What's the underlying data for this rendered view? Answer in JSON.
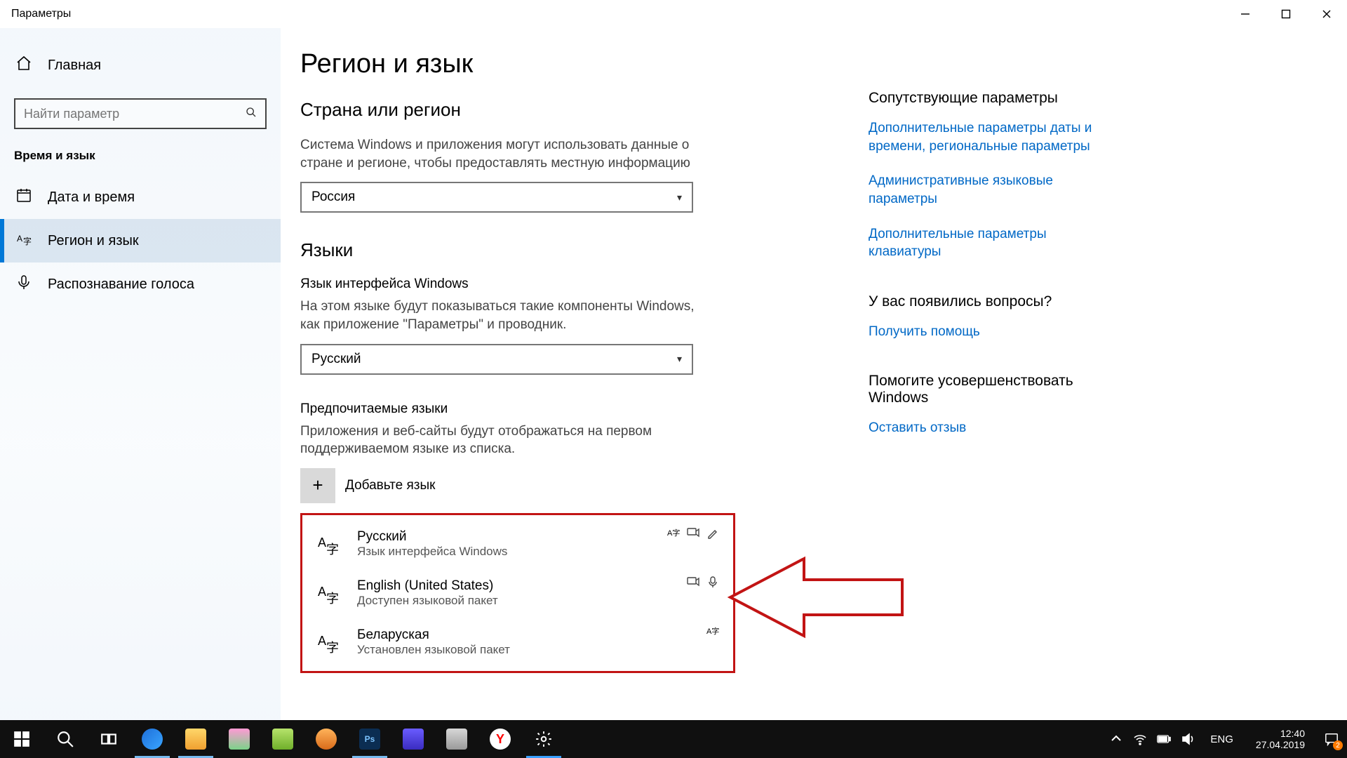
{
  "window": {
    "title": "Параметры"
  },
  "sidebar": {
    "home": "Главная",
    "search_placeholder": "Найти параметр",
    "section": "Время и язык",
    "items": [
      {
        "label": "Дата и время"
      },
      {
        "label": "Регион и язык"
      },
      {
        "label": "Распознавание голоса"
      }
    ]
  },
  "main": {
    "title": "Регион и язык",
    "region": {
      "heading": "Страна или регион",
      "desc": "Система Windows и приложения могут использовать данные о стране и регионе, чтобы предоставлять местную информацию",
      "value": "Россия"
    },
    "languages": {
      "heading": "Языки",
      "uilang_label": "Язык интерфейса Windows",
      "uilang_desc": "На этом языке будут показываться такие компоненты Windows, как приложение \"Параметры\" и проводник.",
      "uilang_value": "Русский",
      "pref_label": "Предпочитаемые языки",
      "pref_desc": "Приложения и веб-сайты будут отображаться на первом поддерживаемом языке из списка.",
      "add_label": "Добавьте язык",
      "list": [
        {
          "name": "Русский",
          "sub": "Язык интерфейса Windows",
          "caps": [
            "display",
            "tts",
            "ink"
          ]
        },
        {
          "name": "English (United States)",
          "sub": "Доступен языковой пакет",
          "caps": [
            "tts",
            "speech"
          ]
        },
        {
          "name": "Беларуская",
          "sub": "Установлен языковой пакет",
          "caps": [
            "display"
          ]
        }
      ]
    }
  },
  "right": {
    "related_heading": "Сопутствующие параметры",
    "link_date": "Дополнительные параметры даты и времени, региональные параметры",
    "link_admin": "Административные языковые параметры",
    "link_kb": "Дополнительные параметры клавиатуры",
    "help_heading": "У вас появились вопросы?",
    "help_link": "Получить помощь",
    "feedback_heading": "Помогите усовершенствовать Windows",
    "feedback_link": "Оставить отзыв"
  },
  "taskbar": {
    "lang_ind": "ENG",
    "time": "12:40",
    "date": "27.04.2019",
    "notif_count": "2"
  }
}
